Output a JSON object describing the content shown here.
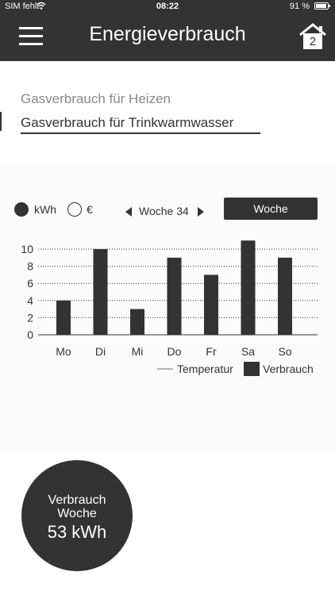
{
  "status_bar": {
    "carrier": "SIM fehlt",
    "time": "08:22",
    "battery": "91 %"
  },
  "header": {
    "title": "Energieverbrauch",
    "home_badge": "2"
  },
  "options": {
    "item1": "Gasverbrauch für Heizen",
    "item2": "Gasverbrauch für Trinkwarmwasser"
  },
  "controls": {
    "unit_kwh": "kWh",
    "unit_eur": "€",
    "week_label": "Woche 34",
    "period_button": "Woche"
  },
  "chart_data": {
    "type": "bar",
    "categories": [
      "Mo",
      "Di",
      "Mi",
      "Do",
      "Fr",
      "Sa",
      "So"
    ],
    "values": [
      4,
      10,
      3,
      9,
      7,
      11,
      9
    ],
    "yticks": [
      0,
      2,
      4,
      6,
      8,
      10
    ],
    "ylim": [
      0,
      11
    ],
    "grid": true,
    "legend": [
      "Temperatur",
      "Verbrauch"
    ],
    "legend_position": "bottom-right"
  },
  "summary": {
    "line1": "Verbrauch",
    "line2": "Woche",
    "value": "53 kWh"
  },
  "colors": {
    "dark": "#333333"
  }
}
